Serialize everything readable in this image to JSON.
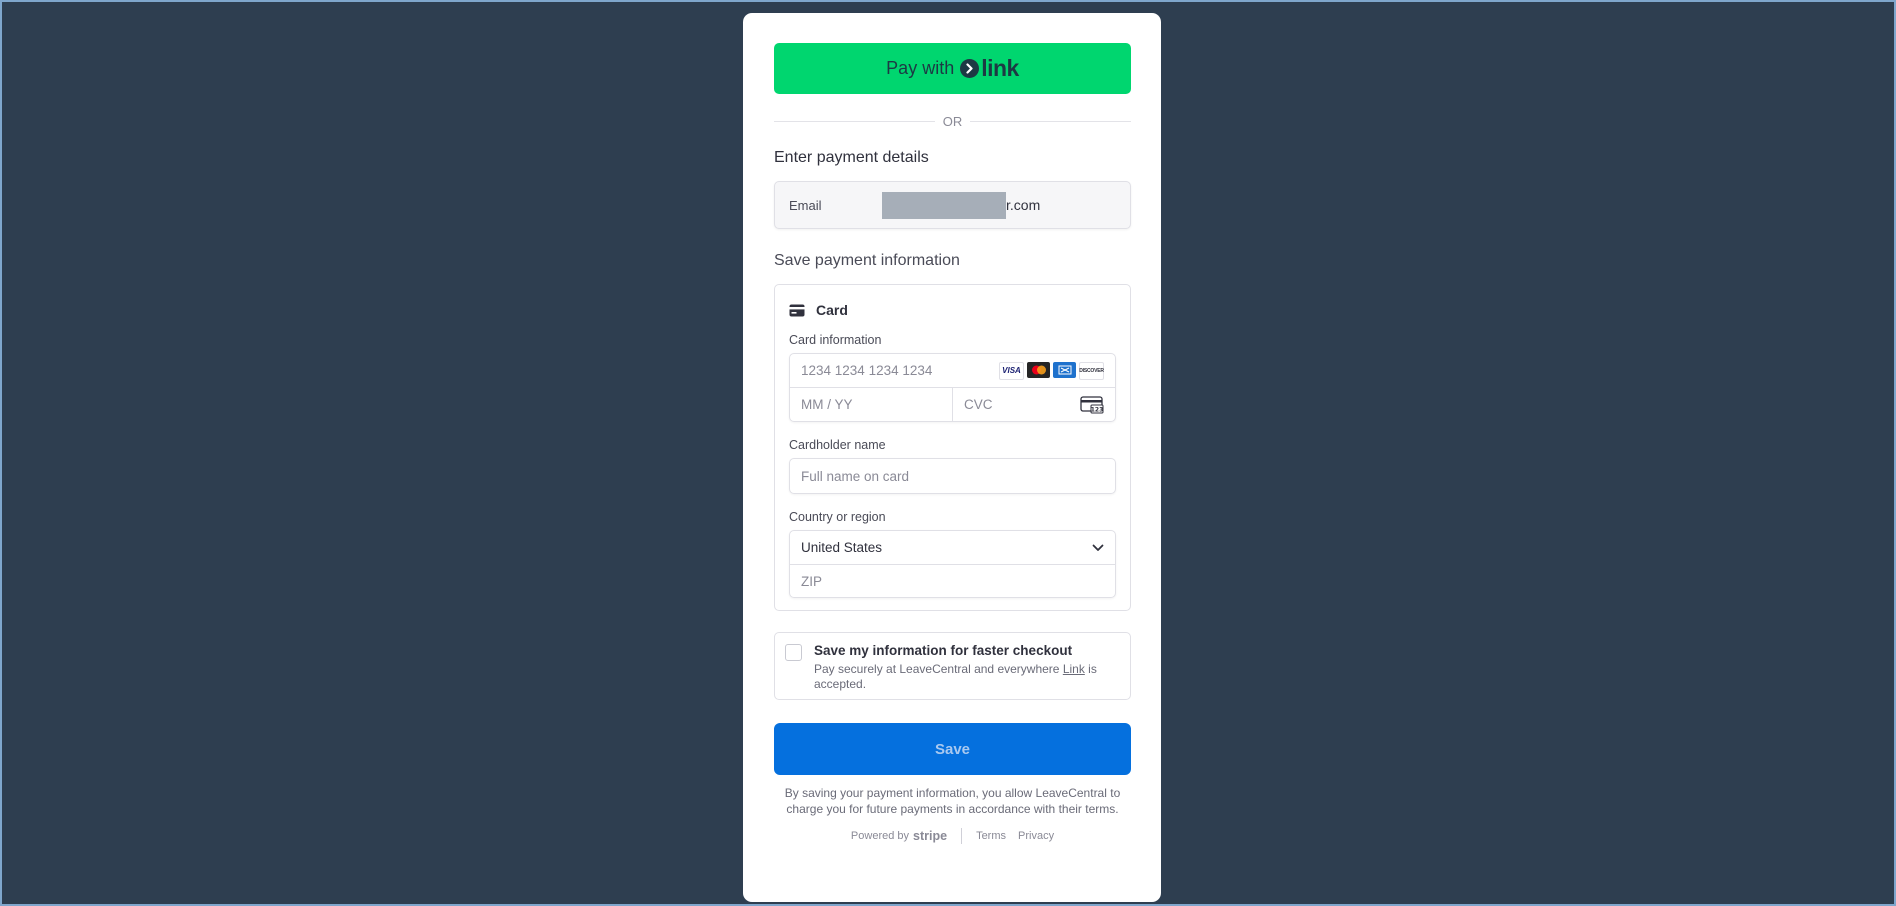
{
  "link_button": {
    "prefix": "Pay with",
    "brand": "link"
  },
  "divider": {
    "text": "OR"
  },
  "payment_details": {
    "title": "Enter payment details"
  },
  "email": {
    "label": "Email",
    "visible_suffix": "r.com"
  },
  "save_section": {
    "title": "Save payment information"
  },
  "card": {
    "method_label": "Card",
    "info_label": "Card information",
    "number_placeholder": "1234 1234 1234 1234",
    "expiry_placeholder": "MM / YY",
    "cvc_placeholder": "CVC",
    "brands": [
      "VISA",
      "MC",
      "AMEX",
      "DISCOVER"
    ],
    "cardholder_label": "Cardholder name",
    "cardholder_placeholder": "Full name on card",
    "country_label": "Country or region",
    "country_value": "United States",
    "zip_placeholder": "ZIP"
  },
  "save_info": {
    "title": "Save my information for faster checkout",
    "desc_before": "Pay securely at LeaveCentral and everywhere ",
    "desc_link": "Link",
    "desc_after": " is accepted.",
    "checked": false
  },
  "save_button": {
    "label": "Save"
  },
  "legal": {
    "text": "By saving your payment information, you allow LeaveCentral to charge you for future payments in accordance with their terms."
  },
  "footer": {
    "powered_by": "Powered by",
    "stripe": "stripe",
    "terms": "Terms",
    "privacy": "Privacy"
  },
  "colors": {
    "link_green": "#00d66f",
    "save_blue": "#0570de",
    "background": "#2e3e50"
  }
}
